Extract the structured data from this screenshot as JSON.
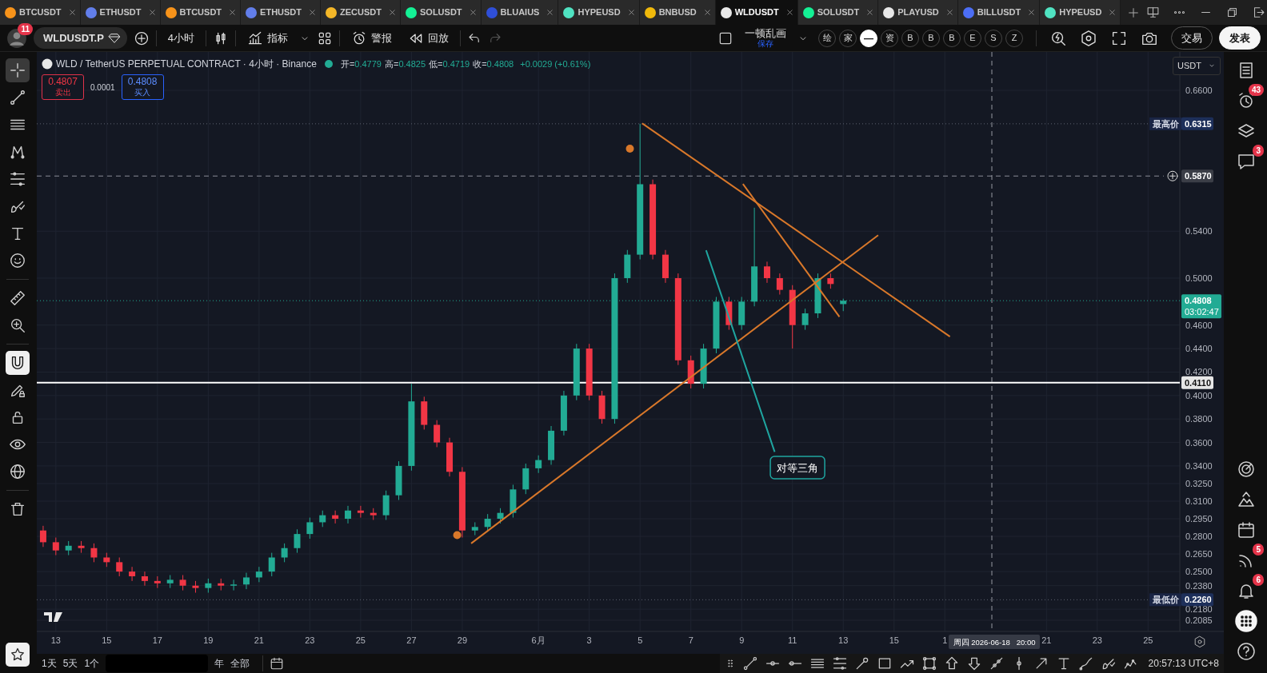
{
  "tabs": [
    {
      "label": "BTCUSDT",
      "color": "#f7931a",
      "selected": false
    },
    {
      "label": "ETHUSDT",
      "color": "#627eea",
      "selected": false
    },
    {
      "label": "BTCUSDT",
      "color": "#f7931a",
      "selected": false
    },
    {
      "label": "ETHUSDT",
      "color": "#627eea",
      "selected": false
    },
    {
      "label": "ZECUSDT",
      "color": "#f4b728",
      "selected": false
    },
    {
      "label": "SOLUSDT",
      "color": "#14f195",
      "selected": false
    },
    {
      "label": "BLUAIUS",
      "color": "#2f4fd8",
      "selected": false
    },
    {
      "label": "HYPEUSD",
      "color": "#50e3c2",
      "selected": false
    },
    {
      "label": "BNBUSD",
      "color": "#f0b90b",
      "selected": false
    },
    {
      "label": "WLDUSDT",
      "color": "#e8e8e8",
      "selected": true
    },
    {
      "label": "SOLUSDT",
      "color": "#14f195",
      "selected": false
    },
    {
      "label": "PLAYUSD",
      "color": "#e8e8e8",
      "selected": false
    },
    {
      "label": "BILLUSDT",
      "color": "#4c6ef5",
      "selected": false
    },
    {
      "label": "HYPEUSD",
      "color": "#50e3c2",
      "selected": false
    }
  ],
  "toolbar": {
    "avatar_badge": "11",
    "symbol": "WLDUSDT.P",
    "interval": "4小时",
    "indicators": "指标",
    "alert": "警报",
    "replay": "回放",
    "history": [
      {
        "kind": "undo",
        "disabled": false
      },
      {
        "kind": "redo",
        "disabled": true
      }
    ],
    "layout_name": "一顿乱画",
    "layout_status": "保存",
    "chips": [
      {
        "label": "绘",
        "selected": false
      },
      {
        "label": "家",
        "selected": false
      },
      {
        "label": "—",
        "selected": true
      },
      {
        "label": "资",
        "selected": false
      },
      {
        "label": "B",
        "selected": false
      },
      {
        "label": "B",
        "selected": false
      },
      {
        "label": "B",
        "selected": false
      },
      {
        "label": "E",
        "selected": false
      },
      {
        "label": "S",
        "selected": false
      },
      {
        "label": "Z",
        "selected": false
      }
    ],
    "trade": "交易",
    "publish": "发表"
  },
  "left_tools": [
    {
      "kind": "crosshair",
      "selected": true
    },
    {
      "kind": "trend-line",
      "selected": false
    },
    {
      "kind": "horizontal-lines",
      "selected": false
    },
    {
      "kind": "pattern",
      "selected": false
    },
    {
      "kind": "fib-levels",
      "selected": false
    },
    {
      "kind": "brush",
      "selected": false
    },
    {
      "kind": "letter-t",
      "selected": false
    },
    {
      "kind": "smiley",
      "selected": false
    },
    {
      "kind": "divider"
    },
    {
      "kind": "ruler",
      "selected": false
    },
    {
      "kind": "zoom-in",
      "selected": false
    },
    {
      "kind": "divider"
    },
    {
      "kind": "magnet",
      "selected": true
    },
    {
      "kind": "pencil-lock",
      "selected": false
    },
    {
      "kind": "lock",
      "selected": false
    },
    {
      "kind": "eye",
      "selected": false
    },
    {
      "kind": "globe",
      "selected": false
    },
    {
      "kind": "divider"
    },
    {
      "kind": "trash",
      "selected": false
    }
  ],
  "chart": {
    "legend": {
      "title": "WLD / TetherUS PERPETUAL CONTRACT · 4小时 · Binance",
      "fields": [
        {
          "label": "开=",
          "value": "0.4779"
        },
        {
          "label": "高=",
          "value": "0.4825"
        },
        {
          "label": "低=",
          "value": "0.4719"
        },
        {
          "label": "收=",
          "value": "0.4808"
        }
      ],
      "change": "+0.0029 (+0.61%)"
    },
    "sell": {
      "price": "0.4807",
      "label": "卖出"
    },
    "spread": "0.0001",
    "buy": {
      "price": "0.4808",
      "label": "买入"
    },
    "currency": "USDT",
    "price_tags": [
      {
        "kind": "high",
        "label": "最高价",
        "value": "0.6315"
      },
      {
        "kind": "alert",
        "value": "0.5870"
      },
      {
        "kind": "last",
        "value": "0.4808",
        "countdown": "03:02:47"
      },
      {
        "kind": "line",
        "value": "0.4110"
      },
      {
        "kind": "low",
        "label": "最低价",
        "value": "0.2260"
      }
    ],
    "crosshair_label": "周四 2026-06-18   20:00",
    "chart_data": {
      "type": "candlestick",
      "categories": [
        null,
        "13",
        null,
        null,
        null,
        "15",
        null,
        null,
        null,
        "17",
        null,
        null,
        null,
        "19",
        null,
        null,
        null,
        "21",
        null,
        null,
        null,
        "23",
        null,
        null,
        null,
        "25",
        null,
        null,
        null,
        "27",
        null,
        null,
        null,
        "29",
        null,
        null,
        null,
        null,
        null,
        "6月",
        null,
        null,
        null,
        "3",
        null,
        null,
        null,
        "5",
        null,
        null,
        null,
        "7",
        null,
        null,
        null,
        "9",
        null,
        null,
        null,
        "11",
        null,
        null,
        null,
        "13",
        null,
        null,
        null,
        "15",
        null,
        null,
        null,
        "1",
        null,
        null,
        null,
        null,
        null,
        null,
        null,
        "21",
        null,
        null,
        null,
        "23",
        null,
        null,
        null,
        "25",
        null,
        null
      ],
      "ohlc": [
        [
          0.285,
          0.289,
          0.271,
          0.275
        ],
        [
          0.275,
          0.279,
          0.264,
          0.268
        ],
        [
          0.268,
          0.276,
          0.264,
          0.272
        ],
        [
          0.272,
          0.276,
          0.266,
          0.27
        ],
        [
          0.27,
          0.274,
          0.258,
          0.262
        ],
        [
          0.262,
          0.266,
          0.254,
          0.258
        ],
        [
          0.258,
          0.262,
          0.246,
          0.25
        ],
        [
          0.25,
          0.254,
          0.242,
          0.246
        ],
        [
          0.246,
          0.25,
          0.238,
          0.242
        ],
        [
          0.242,
          0.246,
          0.236,
          0.24
        ],
        [
          0.24,
          0.247,
          0.236,
          0.243
        ],
        [
          0.243,
          0.247,
          0.234,
          0.238
        ],
        [
          0.238,
          0.242,
          0.232,
          0.236
        ],
        [
          0.236,
          0.244,
          0.232,
          0.24
        ],
        [
          0.24,
          0.244,
          0.234,
          0.238
        ],
        [
          0.238,
          0.243,
          0.234,
          0.239
        ],
        [
          0.239,
          0.249,
          0.235,
          0.245
        ],
        [
          0.245,
          0.254,
          0.241,
          0.25
        ],
        [
          0.25,
          0.266,
          0.246,
          0.262
        ],
        [
          0.262,
          0.274,
          0.258,
          0.27
        ],
        [
          0.27,
          0.286,
          0.266,
          0.282
        ],
        [
          0.282,
          0.296,
          0.278,
          0.292
        ],
        [
          0.292,
          0.302,
          0.288,
          0.298
        ],
        [
          0.298,
          0.302,
          0.291,
          0.295
        ],
        [
          0.295,
          0.306,
          0.291,
          0.302
        ],
        [
          0.302,
          0.306,
          0.296,
          0.3
        ],
        [
          0.3,
          0.304,
          0.294,
          0.298
        ],
        [
          0.298,
          0.319,
          0.294,
          0.315
        ],
        [
          0.315,
          0.344,
          0.311,
          0.34
        ],
        [
          0.34,
          0.41,
          0.336,
          0.395
        ],
        [
          0.395,
          0.399,
          0.371,
          0.375
        ],
        [
          0.375,
          0.379,
          0.356,
          0.36
        ],
        [
          0.36,
          0.364,
          0.331,
          0.335
        ],
        [
          0.335,
          0.339,
          0.279,
          0.285
        ],
        [
          0.285,
          0.292,
          0.281,
          0.288
        ],
        [
          0.288,
          0.299,
          0.284,
          0.295
        ],
        [
          0.295,
          0.304,
          0.291,
          0.3
        ],
        [
          0.3,
          0.324,
          0.296,
          0.32
        ],
        [
          0.32,
          0.342,
          0.316,
          0.338
        ],
        [
          0.338,
          0.349,
          0.334,
          0.345
        ],
        [
          0.345,
          0.374,
          0.341,
          0.37
        ],
        [
          0.37,
          0.404,
          0.366,
          0.4
        ],
        [
          0.4,
          0.444,
          0.396,
          0.44
        ],
        [
          0.44,
          0.444,
          0.396,
          0.4
        ],
        [
          0.4,
          0.404,
          0.376,
          0.38
        ],
        [
          0.38,
          0.504,
          0.376,
          0.5
        ],
        [
          0.5,
          0.524,
          0.496,
          0.52
        ],
        [
          0.52,
          0.6315,
          0.516,
          0.58
        ],
        [
          0.58,
          0.584,
          0.516,
          0.52
        ],
        [
          0.52,
          0.524,
          0.496,
          0.5
        ],
        [
          0.5,
          0.504,
          0.426,
          0.43
        ],
        [
          0.43,
          0.434,
          0.406,
          0.41
        ],
        [
          0.41,
          0.444,
          0.406,
          0.44
        ],
        [
          0.44,
          0.484,
          0.436,
          0.48
        ],
        [
          0.48,
          0.484,
          0.456,
          0.46
        ],
        [
          0.46,
          0.484,
          0.456,
          0.48
        ],
        [
          0.48,
          0.56,
          0.476,
          0.51
        ],
        [
          0.51,
          0.514,
          0.496,
          0.5
        ],
        [
          0.5,
          0.504,
          0.486,
          0.49
        ],
        [
          0.49,
          0.494,
          0.44,
          0.46
        ],
        [
          0.46,
          0.474,
          0.456,
          0.47
        ],
        [
          0.47,
          0.504,
          0.466,
          0.5
        ],
        [
          0.5,
          0.504,
          0.491,
          0.495
        ],
        [
          0.4779,
          0.4825,
          0.4719,
          0.4808
        ],
        null,
        null,
        null,
        null,
        null,
        null,
        null,
        null,
        null,
        null,
        null,
        null,
        null,
        null,
        null,
        null,
        null,
        null,
        null,
        null,
        null,
        null,
        null,
        null,
        null,
        null
      ],
      "ylim": [
        0.199,
        0.6927
      ],
      "yticks": [
        {
          "value": 0.66,
          "label": "0.6600"
        },
        {
          "value": 0.54,
          "label": "0.5400"
        },
        {
          "value": 0.5,
          "label": "0.5000"
        },
        {
          "value": 0.46,
          "label": "0.4600"
        },
        {
          "value": 0.44,
          "label": "0.4400"
        },
        {
          "value": 0.42,
          "label": "0.4200"
        },
        {
          "value": 0.4,
          "label": "0.4000"
        },
        {
          "value": 0.38,
          "label": "0.3800"
        },
        {
          "value": 0.36,
          "label": "0.3600"
        },
        {
          "value": 0.34,
          "label": "0.3400"
        },
        {
          "value": 0.325,
          "label": "0.3250"
        },
        {
          "value": 0.31,
          "label": "0.3100"
        },
        {
          "value": 0.295,
          "label": "0.2950"
        },
        {
          "value": 0.28,
          "label": "0.2800"
        },
        {
          "value": 0.265,
          "label": "0.2650"
        },
        {
          "value": 0.25,
          "label": "0.2500"
        },
        {
          "value": 0.238,
          "label": "0.2380"
        },
        {
          "value": 0.218,
          "label": "0.2180"
        },
        {
          "value": 0.2085,
          "label": "0.2085"
        }
      ],
      "grid": true,
      "ref_lines": [
        {
          "axis": "y",
          "value": 0.6315,
          "color": "#5d6170"
        },
        {
          "axis": "y",
          "value": 0.587,
          "color": "#8a8d96"
        },
        {
          "axis": "y",
          "value": 0.4808,
          "color": "#22ab94"
        },
        {
          "axis": "y",
          "value": 0.411,
          "color": "#ffffff"
        },
        {
          "axis": "y",
          "value": 0.226,
          "color": "#5d6170"
        }
      ],
      "annotations": [
        "对等三角"
      ]
    }
  },
  "right_sidebar": [
    {
      "kind": "watchlist"
    },
    {
      "kind": "alarm-clock",
      "badge": "43"
    },
    {
      "kind": "layers"
    },
    {
      "kind": "chat",
      "badge": "3"
    },
    {
      "kind": "spacer"
    },
    {
      "kind": "radar"
    },
    {
      "kind": "mountains"
    },
    {
      "kind": "calendar"
    },
    {
      "kind": "rss",
      "badge": "5"
    },
    {
      "kind": "bell",
      "badge": "6"
    },
    {
      "kind": "apps"
    },
    {
      "kind": "help"
    }
  ],
  "bottom_bar": {
    "ranges": [
      "1天",
      "5天",
      "1个",
      "年",
      "全部"
    ],
    "draw_tools": [
      {
        "kind": "grip"
      },
      {
        "kind": "trend-line"
      },
      {
        "kind": "ray"
      },
      {
        "kind": "segment"
      },
      {
        "kind": "horizontal-lines"
      },
      {
        "kind": "fib-levels"
      },
      {
        "kind": "pen"
      },
      {
        "kind": "rectangle"
      },
      {
        "kind": "path-arrow"
      },
      {
        "kind": "rect-corners"
      },
      {
        "kind": "arrow-up"
      },
      {
        "kind": "arrow-down"
      },
      {
        "kind": "measure"
      },
      {
        "kind": "vertical-line"
      },
      {
        "kind": "arrow-diagonal"
      },
      {
        "kind": "letter-t"
      },
      {
        "kind": "curve"
      },
      {
        "kind": "brush"
      },
      {
        "kind": "wave"
      }
    ],
    "time": "20:57:13 UTC+8"
  }
}
